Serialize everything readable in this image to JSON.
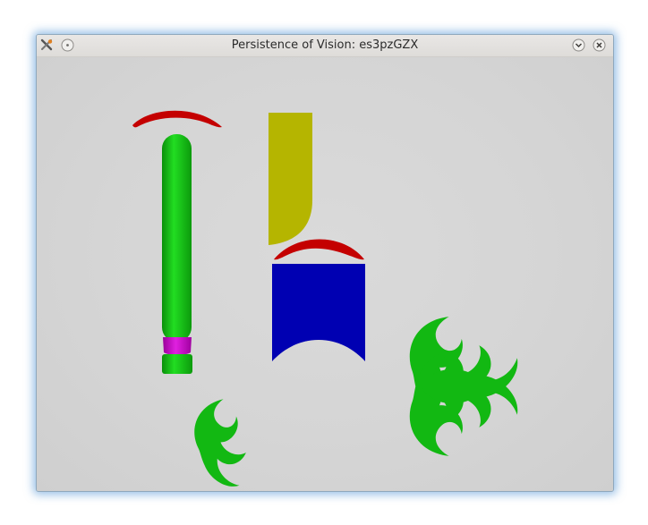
{
  "window": {
    "title": "Persistence of Vision: es3pzGZX"
  },
  "titlebar": {
    "app_icon": "povray-tools-icon",
    "left_button_icon": "circle-dot-icon",
    "minimize_icon": "chevron-down-icon",
    "close_icon": "close-icon"
  },
  "scene": {
    "background_color": "#d6d6d6",
    "objects": [
      {
        "name": "red-arc-top-left",
        "color": "#c40000"
      },
      {
        "name": "green-capsule-column",
        "color": "#11c411"
      },
      {
        "name": "magenta-collar",
        "color": "#c000c0"
      },
      {
        "name": "green-base-disc",
        "color": "#11c411"
      },
      {
        "name": "yellow-rounded-block",
        "color": "#b5b500"
      },
      {
        "name": "red-arc-center",
        "color": "#c40000"
      },
      {
        "name": "blue-cutout-block",
        "color": "#0000b2"
      },
      {
        "name": "green-flourish-small",
        "color": "#12b812"
      },
      {
        "name": "green-flourish-cluster",
        "color": "#12b812"
      }
    ]
  }
}
